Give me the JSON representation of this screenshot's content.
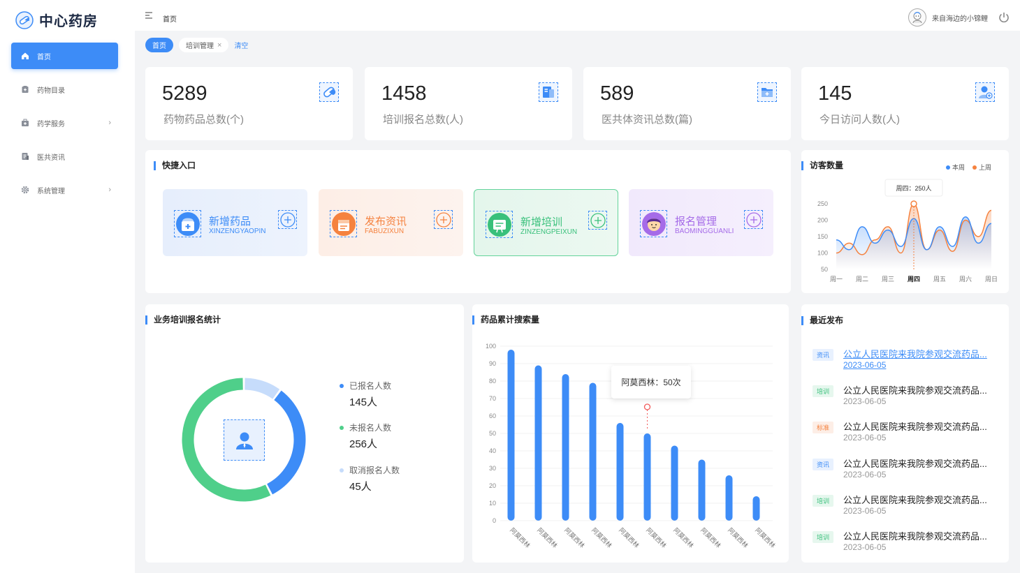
{
  "app": {
    "name": "中心药房"
  },
  "nav": [
    {
      "label": "首页",
      "icon": "home-icon",
      "active": true
    },
    {
      "label": "药物目录",
      "icon": "catalog-icon"
    },
    {
      "label": "药学服务",
      "icon": "service-icon",
      "chevron": true
    },
    {
      "label": "医共资讯",
      "icon": "news-icon"
    },
    {
      "label": "系统管理",
      "icon": "gear-icon",
      "chevron": true
    }
  ],
  "topbar": {
    "breadcrumb": "首页",
    "username": "来自海边的小锦鲤"
  },
  "tabs": {
    "home": "首页",
    "training": "培训管理",
    "clear": "清空"
  },
  "stats": [
    {
      "value": "5289",
      "label": "药物药品总数(个)",
      "icon": "pill-icon"
    },
    {
      "value": "1458",
      "label": "培训报名总数(人)",
      "icon": "book-icon"
    },
    {
      "value": "589",
      "label": "医共体资讯总数(篇)",
      "icon": "folder-icon"
    },
    {
      "value": "145",
      "label": "今日访问人数(人)",
      "icon": "user-add-icon"
    }
  ],
  "quick": {
    "title": "快捷入口",
    "items": [
      {
        "title": "新增药品",
        "subtitle": "XINZENGYAOPIN",
        "color": "#3d8cf7"
      },
      {
        "title": "发布资讯",
        "subtitle": "FABUZIXUN",
        "color": "#f5823f"
      },
      {
        "title": "新增培训",
        "subtitle": "ZINZENGPEIXUN",
        "color": "#39c07b"
      },
      {
        "title": "报名管理",
        "subtitle": "BAOMINGGUANLI",
        "color": "#a56be8"
      }
    ]
  },
  "visitors": {
    "title": "访客数量",
    "legend": [
      "本周",
      "上周"
    ],
    "tooltip": "周四：250人"
  },
  "training_stats": {
    "title": "业务培训报名统计",
    "items": [
      {
        "label": "已报名人数",
        "value": "145人",
        "color": "#3d8cf7"
      },
      {
        "label": "未报名人数",
        "value": "256人",
        "color": "#4fcf8a"
      },
      {
        "label": "取消报名人数",
        "value": "45人",
        "color": "#c6dcfb"
      }
    ]
  },
  "search": {
    "title": "药品累计搜索量",
    "tooltip": "阿莫西林：50次"
  },
  "news": {
    "title": "最近发布",
    "items": [
      {
        "tag": "资讯",
        "title": "公立人民医院来我院参观交流药品...",
        "date": "2023-06-05",
        "link": true
      },
      {
        "tag": "培训",
        "title": "公立人民医院来我院参观交流药品...",
        "date": "2023-06-05"
      },
      {
        "tag": "标准",
        "title": "公立人民医院来我院参观交流药品...",
        "date": "2023-06-05"
      },
      {
        "tag": "资讯",
        "title": "公立人民医院来我院参观交流药品...",
        "date": "2023-06-05"
      },
      {
        "tag": "培训",
        "title": "公立人民医院来我院参观交流药品...",
        "date": "2023-06-05"
      },
      {
        "tag": "培训",
        "title": "公立人民医院来我院参观交流药品...",
        "date": "2023-06-05"
      }
    ]
  },
  "colors": {
    "accent": "#3d8cf7",
    "orange": "#f5823f",
    "green": "#39c07b",
    "purple": "#a56be8"
  },
  "chart_data": [
    {
      "type": "line",
      "categories": [
        "周一",
        "周二",
        "周三",
        "周四",
        "周五",
        "周六",
        "周日"
      ],
      "series": [
        {
          "name": "本周",
          "values": [
            140,
            110,
            180,
            130,
            170,
            120,
            205,
            110,
            180,
            120,
            210,
            130,
            190
          ]
        },
        {
          "name": "上周",
          "values": [
            100,
            130,
            95,
            140,
            180,
            100,
            250,
            110,
            170,
            105,
            200,
            150,
            230
          ]
        }
      ],
      "ylim": [
        50,
        250
      ],
      "yticks": [
        50,
        100,
        150,
        200,
        250
      ]
    },
    {
      "type": "bar",
      "categories": [
        "阿莫西林",
        "阿莫西林",
        "阿莫西林",
        "阿莫西林",
        "阿莫西林",
        "阿莫西林",
        "阿莫西林",
        "阿莫西林",
        "阿莫西林",
        "阿莫西林"
      ],
      "values": [
        98,
        89,
        84,
        79,
        56,
        50,
        43,
        35,
        26,
        14
      ],
      "ylim": [
        0,
        100
      ],
      "yticks": [
        0,
        10,
        20,
        30,
        40,
        50,
        60,
        70,
        80,
        90,
        100
      ]
    },
    {
      "type": "pie",
      "categories": [
        "已报名人数",
        "未报名人数",
        "取消报名人数"
      ],
      "values": [
        145,
        256,
        45
      ]
    }
  ]
}
